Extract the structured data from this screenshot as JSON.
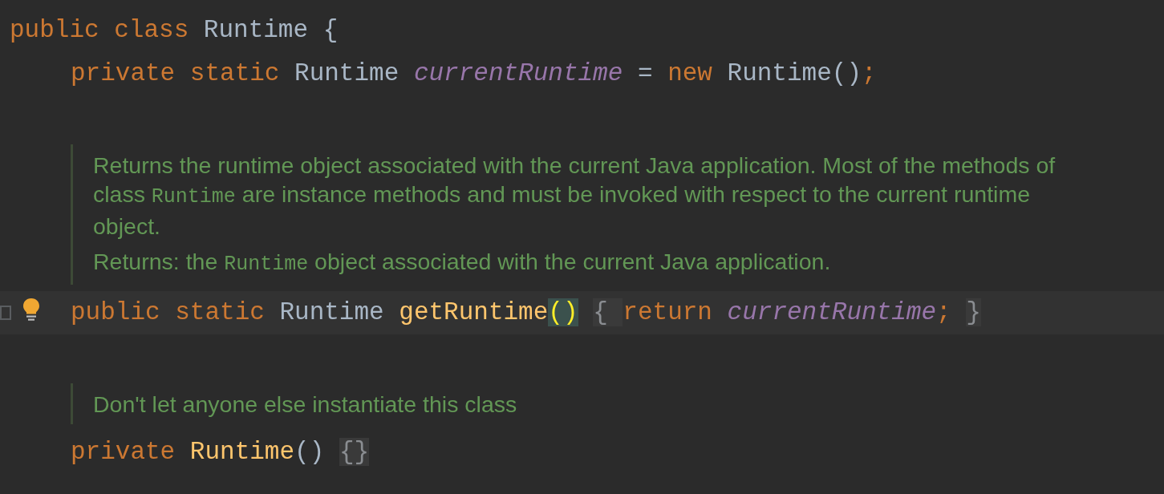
{
  "editor": {
    "lines": [
      {
        "kind": "code",
        "tokens": [
          {
            "kind": "keyword",
            "text": "public class "
          },
          {
            "kind": "type",
            "text": "Runtime "
          },
          {
            "kind": "plain",
            "text": "{"
          }
        ],
        "children": [
          {
            "kind": "code",
            "tokens": [
              {
                "kind": "keyword",
                "text": "private static "
              },
              {
                "kind": "type",
                "text": "Runtime "
              },
              {
                "kind": "field",
                "text": "currentRuntime"
              },
              {
                "kind": "plain",
                "text": " = "
              },
              {
                "kind": "keyword",
                "text": "new "
              },
              {
                "kind": "type",
                "text": "Runtime()"
              },
              {
                "kind": "keyword",
                "text": ";"
              }
            ]
          },
          {
            "kind": "blank"
          },
          {
            "kind": "doc",
            "paragraphs": [
              [
                {
                  "kind": "text",
                  "text": "Returns the runtime object associated with the current Java application. Most of the methods of class "
                },
                {
                  "kind": "code",
                  "text": "Runtime"
                },
                {
                  "kind": "text",
                  "text": " are instance methods and must be invoked with respect to the current runtime object."
                }
              ],
              [
                {
                  "kind": "text",
                  "text": "Returns: the "
                },
                {
                  "kind": "code",
                  "text": "Runtime"
                },
                {
                  "kind": "text",
                  "text": " object associated with the current Java application."
                }
              ]
            ]
          },
          {
            "kind": "code",
            "current": true,
            "bulb": true,
            "fold": true,
            "tokens": [
              {
                "kind": "keyword",
                "text": "public static "
              },
              {
                "kind": "type",
                "text": "Runtime "
              },
              {
                "kind": "method",
                "text": "getRuntime"
              },
              {
                "kind": "paren-match",
                "text": "()"
              },
              {
                "kind": "folded",
                "text": "{ "
              },
              {
                "kind": "keyword",
                "text": "return "
              },
              {
                "kind": "field",
                "text": "currentRuntime"
              },
              {
                "kind": "keyword",
                "text": ";"
              },
              {
                "kind": "folded",
                "text": "}"
              }
            ]
          },
          {
            "kind": "blank"
          },
          {
            "kind": "doc",
            "paragraphs": [
              [
                {
                  "kind": "text",
                  "text": "Don't let anyone else instantiate this class"
                }
              ]
            ]
          },
          {
            "kind": "code",
            "tokens": [
              {
                "kind": "keyword",
                "text": "private "
              },
              {
                "kind": "method",
                "text": "Runtime"
              },
              {
                "kind": "plain",
                "text": "()"
              },
              {
                "kind": "folded",
                "text": "{}"
              }
            ]
          }
        ]
      }
    ]
  }
}
